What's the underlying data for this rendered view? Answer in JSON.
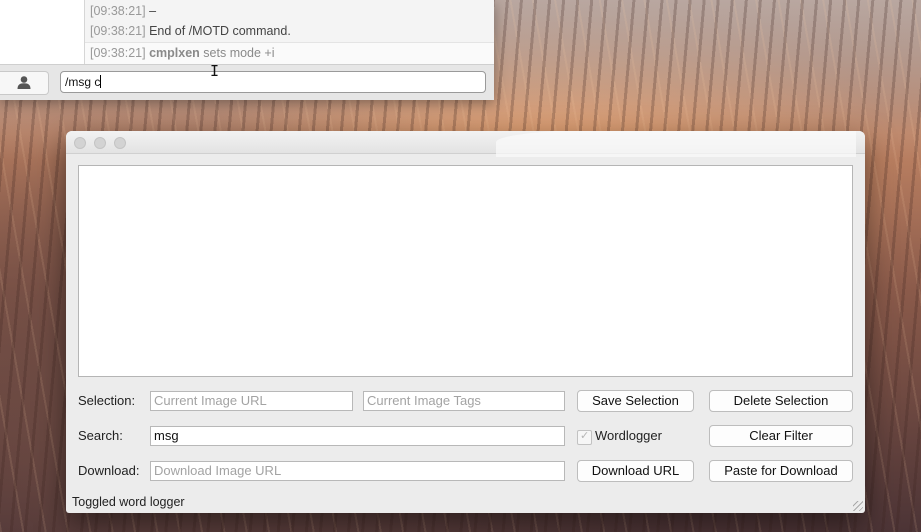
{
  "chat": {
    "log": [
      {
        "time": "[09:38:21]",
        "text": "–"
      },
      {
        "time": "[09:38:21]",
        "text": "End of /MOTD command."
      },
      {
        "time": "[09:38:21]",
        "nick": "cmplxen",
        "text": "sets mode +i"
      }
    ],
    "input_value": "/msg c",
    "user_icon": "person-icon"
  },
  "window": {
    "traffic_lights": [
      "close",
      "minimize",
      "zoom"
    ],
    "selection": {
      "label": "Selection:",
      "url_placeholder": "Current Image URL",
      "tags_placeholder": "Current Image Tags",
      "save_button": "Save Selection",
      "delete_button": "Delete Selection"
    },
    "search": {
      "label": "Search:",
      "value": "msg",
      "checkbox_label": "Wordlogger",
      "checkbox_checked": true,
      "clear_button": "Clear Filter"
    },
    "download": {
      "label": "Download:",
      "url_placeholder": "Download Image URL",
      "download_button": "Download URL",
      "paste_button": "Paste for Download"
    },
    "status_text": "Toggled word logger"
  }
}
